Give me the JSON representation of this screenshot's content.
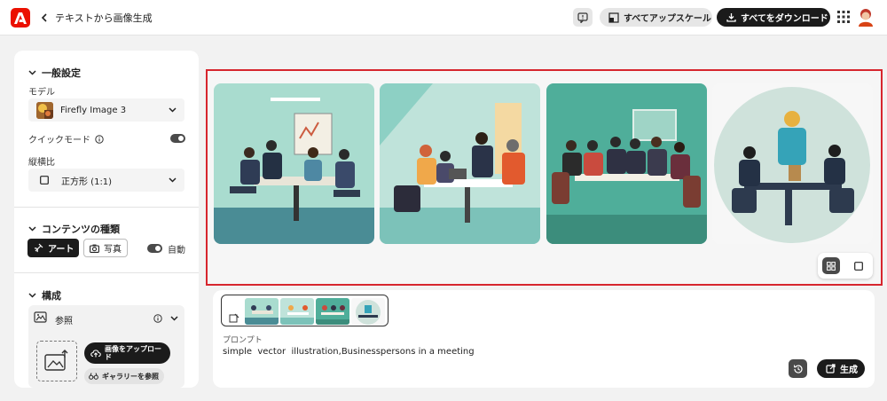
{
  "header": {
    "breadcrumb": "テキストから画像生成",
    "upscale_all_label": "すべてアップスケール",
    "download_all_label": "すべてをダウンロード"
  },
  "general_settings": {
    "title": "一般設定",
    "model_label": "モデル",
    "model_value": "Firefly Image 3",
    "quick_mode_label": "クイックモード",
    "quick_mode_on": true,
    "aspect_label": "縦横比",
    "aspect_value": "正方形 (1:1)"
  },
  "content_type": {
    "title": "コンテンツの種類",
    "art_label": "アート",
    "photo_label": "写真",
    "auto_label": "自動",
    "auto_on": true
  },
  "composition": {
    "title": "構成",
    "reference_label": "参照",
    "upload_label": "画像をアップロード",
    "gallery_label": "ギャラリーを参照"
  },
  "prompt": {
    "label": "プロンプト",
    "text": "simple  vector  illustration,Businesspersons in a meeting",
    "generate_label": "生成"
  },
  "colors": {
    "accent_red": "#eb1000",
    "highlight_border": "#d7262e",
    "dark_button": "#1b1b1b"
  }
}
